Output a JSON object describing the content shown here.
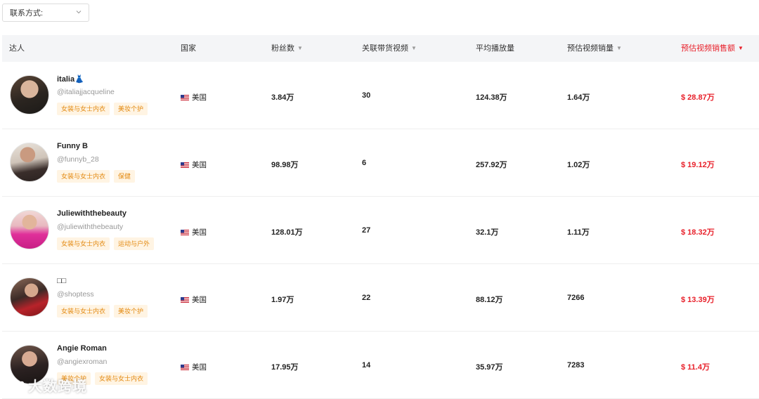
{
  "filter": {
    "label": "联系方式:"
  },
  "table": {
    "headers": {
      "influencer": "达人",
      "country": "国家",
      "followers": "粉丝数",
      "videos": "关联带货视频",
      "avg_views": "平均播放量",
      "est_sales": "预估视频销量",
      "est_revenue": "预估视频销售额"
    },
    "rows": [
      {
        "name": "italia👗",
        "handle": "@italiajjacqueline",
        "tags": [
          "女装与女士内衣",
          "美妆个护"
        ],
        "country": "美国",
        "followers": "3.84万",
        "videos": "30",
        "avg_views": "124.38万",
        "est_sales": "1.64万",
        "est_revenue": "$ 28.87万"
      },
      {
        "name": "Funny B",
        "handle": "@funnyb_28",
        "tags": [
          "女装与女士内衣",
          "保健"
        ],
        "country": "美国",
        "followers": "98.98万",
        "videos": "6",
        "avg_views": "257.92万",
        "est_sales": "1.02万",
        "est_revenue": "$ 19.12万"
      },
      {
        "name": "Juliewiththebeauty",
        "handle": "@juliewiththebeauty",
        "tags": [
          "女装与女士内衣",
          "运动与户外"
        ],
        "country": "美国",
        "followers": "128.01万",
        "videos": "27",
        "avg_views": "32.1万",
        "est_sales": "1.11万",
        "est_revenue": "$ 18.32万"
      },
      {
        "name": "□□",
        "handle": "@shoptess",
        "tags": [
          "女装与女士内衣",
          "美妆个护"
        ],
        "country": "美国",
        "followers": "1.97万",
        "videos": "22",
        "avg_views": "88.12万",
        "est_sales": "7266",
        "est_revenue": "$ 13.39万"
      },
      {
        "name": "Angie Roman",
        "handle": "@angiexroman",
        "tags": [
          "美妆个护",
          "女装与女士内衣"
        ],
        "country": "美国",
        "followers": "17.95万",
        "videos": "14",
        "avg_views": "35.97万",
        "est_sales": "7283",
        "est_revenue": "$ 11.4万"
      }
    ]
  },
  "watermark": {
    "text": "大数跨境"
  },
  "colors": {
    "accent": "#e8202a",
    "tag_bg": "#fff4e3",
    "tag_text": "#e38a12",
    "header_bg": "#f4f5f7"
  }
}
